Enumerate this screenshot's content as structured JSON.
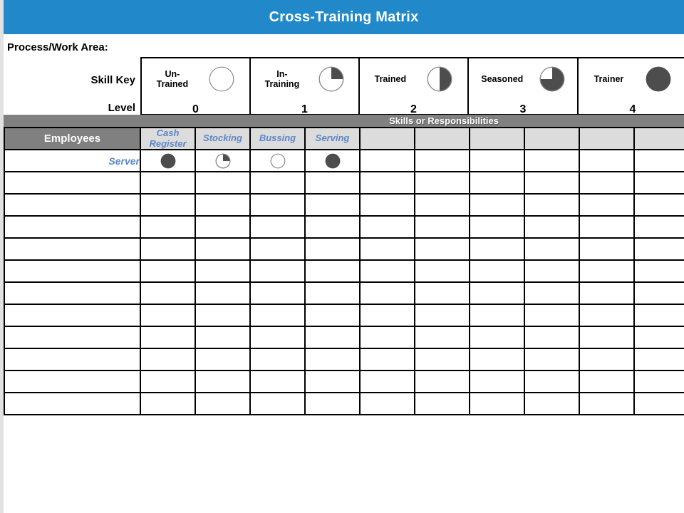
{
  "title": "Cross-Training Matrix",
  "theme": {
    "title_bar": "#2189c9",
    "banner_gray": "#808080",
    "header_fill": "#dcdcdc",
    "accent_blue": "#5b87c5",
    "icon_fill": "#4d4d4d"
  },
  "labels": {
    "process_work_area": "Process/Work Area:",
    "skill_key": "Skill Key",
    "level": "Level",
    "skills_banner": "Skills or Responsibilities",
    "employees": "Employees"
  },
  "skill_key": [
    {
      "name": "Un-\nTrained",
      "name_line1": "Un-",
      "name_line2": "Trained",
      "level": "0",
      "fill": 0,
      "icon": "circle-empty-icon"
    },
    {
      "name": "In-\nTraining",
      "name_line1": "In-",
      "name_line2": "Training",
      "level": "1",
      "fill": 25,
      "icon": "circle-quarter-icon"
    },
    {
      "name": "Trained",
      "name_line1": "Trained",
      "name_line2": "",
      "level": "2",
      "fill": 50,
      "icon": "circle-half-icon"
    },
    {
      "name": "Seasoned",
      "name_line1": "Seasoned",
      "name_line2": "",
      "level": "3",
      "fill": 75,
      "icon": "circle-three-quarter-icon"
    },
    {
      "name": "Trainer",
      "name_line1": "Trainer",
      "name_line2": "",
      "level": "4",
      "fill": 100,
      "icon": "circle-full-icon"
    }
  ],
  "columns": [
    {
      "label": "Cash\nRegister",
      "line1": "Cash",
      "line2": "Register"
    },
    {
      "label": "Stocking",
      "line1": "Stocking",
      "line2": ""
    },
    {
      "label": "Bussing",
      "line1": "Bussing",
      "line2": ""
    },
    {
      "label": "Serving",
      "line1": "Serving",
      "line2": ""
    },
    {
      "label": "",
      "line1": "",
      "line2": ""
    },
    {
      "label": "",
      "line1": "",
      "line2": ""
    },
    {
      "label": "",
      "line1": "",
      "line2": ""
    },
    {
      "label": "",
      "line1": "",
      "line2": ""
    },
    {
      "label": "",
      "line1": "",
      "line2": ""
    },
    {
      "label": "",
      "line1": "",
      "line2": ""
    }
  ],
  "rows": [
    {
      "employee": "Server",
      "levels": [
        4,
        1,
        0,
        4,
        null,
        null,
        null,
        null,
        null,
        null
      ]
    },
    {
      "employee": "",
      "levels": [
        null,
        null,
        null,
        null,
        null,
        null,
        null,
        null,
        null,
        null
      ]
    },
    {
      "employee": "",
      "levels": [
        null,
        null,
        null,
        null,
        null,
        null,
        null,
        null,
        null,
        null
      ]
    },
    {
      "employee": "",
      "levels": [
        null,
        null,
        null,
        null,
        null,
        null,
        null,
        null,
        null,
        null
      ]
    },
    {
      "employee": "",
      "levels": [
        null,
        null,
        null,
        null,
        null,
        null,
        null,
        null,
        null,
        null
      ]
    },
    {
      "employee": "",
      "levels": [
        null,
        null,
        null,
        null,
        null,
        null,
        null,
        null,
        null,
        null
      ]
    },
    {
      "employee": "",
      "levels": [
        null,
        null,
        null,
        null,
        null,
        null,
        null,
        null,
        null,
        null
      ]
    },
    {
      "employee": "",
      "levels": [
        null,
        null,
        null,
        null,
        null,
        null,
        null,
        null,
        null,
        null
      ]
    },
    {
      "employee": "",
      "levels": [
        null,
        null,
        null,
        null,
        null,
        null,
        null,
        null,
        null,
        null
      ]
    },
    {
      "employee": "",
      "levels": [
        null,
        null,
        null,
        null,
        null,
        null,
        null,
        null,
        null,
        null
      ]
    },
    {
      "employee": "",
      "levels": [
        null,
        null,
        null,
        null,
        null,
        null,
        null,
        null,
        null,
        null
      ]
    },
    {
      "employee": "",
      "levels": [
        null,
        null,
        null,
        null,
        null,
        null,
        null,
        null,
        null,
        null
      ]
    }
  ]
}
